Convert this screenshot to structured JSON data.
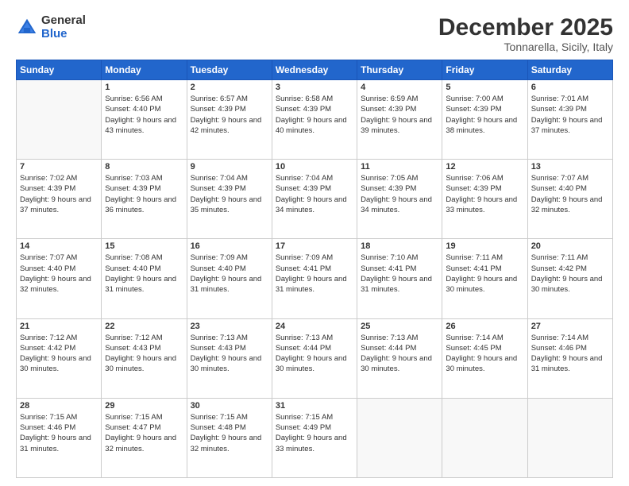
{
  "header": {
    "logo_general": "General",
    "logo_blue": "Blue",
    "title": "December 2025",
    "location": "Tonnarella, Sicily, Italy"
  },
  "days_of_week": [
    "Sunday",
    "Monday",
    "Tuesday",
    "Wednesday",
    "Thursday",
    "Friday",
    "Saturday"
  ],
  "weeks": [
    [
      {
        "num": "",
        "empty": true
      },
      {
        "num": "1",
        "sunrise": "Sunrise: 6:56 AM",
        "sunset": "Sunset: 4:40 PM",
        "daylight": "Daylight: 9 hours and 43 minutes."
      },
      {
        "num": "2",
        "sunrise": "Sunrise: 6:57 AM",
        "sunset": "Sunset: 4:39 PM",
        "daylight": "Daylight: 9 hours and 42 minutes."
      },
      {
        "num": "3",
        "sunrise": "Sunrise: 6:58 AM",
        "sunset": "Sunset: 4:39 PM",
        "daylight": "Daylight: 9 hours and 40 minutes."
      },
      {
        "num": "4",
        "sunrise": "Sunrise: 6:59 AM",
        "sunset": "Sunset: 4:39 PM",
        "daylight": "Daylight: 9 hours and 39 minutes."
      },
      {
        "num": "5",
        "sunrise": "Sunrise: 7:00 AM",
        "sunset": "Sunset: 4:39 PM",
        "daylight": "Daylight: 9 hours and 38 minutes."
      },
      {
        "num": "6",
        "sunrise": "Sunrise: 7:01 AM",
        "sunset": "Sunset: 4:39 PM",
        "daylight": "Daylight: 9 hours and 37 minutes."
      }
    ],
    [
      {
        "num": "7",
        "sunrise": "Sunrise: 7:02 AM",
        "sunset": "Sunset: 4:39 PM",
        "daylight": "Daylight: 9 hours and 37 minutes."
      },
      {
        "num": "8",
        "sunrise": "Sunrise: 7:03 AM",
        "sunset": "Sunset: 4:39 PM",
        "daylight": "Daylight: 9 hours and 36 minutes."
      },
      {
        "num": "9",
        "sunrise": "Sunrise: 7:04 AM",
        "sunset": "Sunset: 4:39 PM",
        "daylight": "Daylight: 9 hours and 35 minutes."
      },
      {
        "num": "10",
        "sunrise": "Sunrise: 7:04 AM",
        "sunset": "Sunset: 4:39 PM",
        "daylight": "Daylight: 9 hours and 34 minutes."
      },
      {
        "num": "11",
        "sunrise": "Sunrise: 7:05 AM",
        "sunset": "Sunset: 4:39 PM",
        "daylight": "Daylight: 9 hours and 34 minutes."
      },
      {
        "num": "12",
        "sunrise": "Sunrise: 7:06 AM",
        "sunset": "Sunset: 4:39 PM",
        "daylight": "Daylight: 9 hours and 33 minutes."
      },
      {
        "num": "13",
        "sunrise": "Sunrise: 7:07 AM",
        "sunset": "Sunset: 4:40 PM",
        "daylight": "Daylight: 9 hours and 32 minutes."
      }
    ],
    [
      {
        "num": "14",
        "sunrise": "Sunrise: 7:07 AM",
        "sunset": "Sunset: 4:40 PM",
        "daylight": "Daylight: 9 hours and 32 minutes."
      },
      {
        "num": "15",
        "sunrise": "Sunrise: 7:08 AM",
        "sunset": "Sunset: 4:40 PM",
        "daylight": "Daylight: 9 hours and 31 minutes."
      },
      {
        "num": "16",
        "sunrise": "Sunrise: 7:09 AM",
        "sunset": "Sunset: 4:40 PM",
        "daylight": "Daylight: 9 hours and 31 minutes."
      },
      {
        "num": "17",
        "sunrise": "Sunrise: 7:09 AM",
        "sunset": "Sunset: 4:41 PM",
        "daylight": "Daylight: 9 hours and 31 minutes."
      },
      {
        "num": "18",
        "sunrise": "Sunrise: 7:10 AM",
        "sunset": "Sunset: 4:41 PM",
        "daylight": "Daylight: 9 hours and 31 minutes."
      },
      {
        "num": "19",
        "sunrise": "Sunrise: 7:11 AM",
        "sunset": "Sunset: 4:41 PM",
        "daylight": "Daylight: 9 hours and 30 minutes."
      },
      {
        "num": "20",
        "sunrise": "Sunrise: 7:11 AM",
        "sunset": "Sunset: 4:42 PM",
        "daylight": "Daylight: 9 hours and 30 minutes."
      }
    ],
    [
      {
        "num": "21",
        "sunrise": "Sunrise: 7:12 AM",
        "sunset": "Sunset: 4:42 PM",
        "daylight": "Daylight: 9 hours and 30 minutes."
      },
      {
        "num": "22",
        "sunrise": "Sunrise: 7:12 AM",
        "sunset": "Sunset: 4:43 PM",
        "daylight": "Daylight: 9 hours and 30 minutes."
      },
      {
        "num": "23",
        "sunrise": "Sunrise: 7:13 AM",
        "sunset": "Sunset: 4:43 PM",
        "daylight": "Daylight: 9 hours and 30 minutes."
      },
      {
        "num": "24",
        "sunrise": "Sunrise: 7:13 AM",
        "sunset": "Sunset: 4:44 PM",
        "daylight": "Daylight: 9 hours and 30 minutes."
      },
      {
        "num": "25",
        "sunrise": "Sunrise: 7:13 AM",
        "sunset": "Sunset: 4:44 PM",
        "daylight": "Daylight: 9 hours and 30 minutes."
      },
      {
        "num": "26",
        "sunrise": "Sunrise: 7:14 AM",
        "sunset": "Sunset: 4:45 PM",
        "daylight": "Daylight: 9 hours and 30 minutes."
      },
      {
        "num": "27",
        "sunrise": "Sunrise: 7:14 AM",
        "sunset": "Sunset: 4:46 PM",
        "daylight": "Daylight: 9 hours and 31 minutes."
      }
    ],
    [
      {
        "num": "28",
        "sunrise": "Sunrise: 7:15 AM",
        "sunset": "Sunset: 4:46 PM",
        "daylight": "Daylight: 9 hours and 31 minutes."
      },
      {
        "num": "29",
        "sunrise": "Sunrise: 7:15 AM",
        "sunset": "Sunset: 4:47 PM",
        "daylight": "Daylight: 9 hours and 32 minutes."
      },
      {
        "num": "30",
        "sunrise": "Sunrise: 7:15 AM",
        "sunset": "Sunset: 4:48 PM",
        "daylight": "Daylight: 9 hours and 32 minutes."
      },
      {
        "num": "31",
        "sunrise": "Sunrise: 7:15 AM",
        "sunset": "Sunset: 4:49 PM",
        "daylight": "Daylight: 9 hours and 33 minutes."
      },
      {
        "num": "",
        "empty": true
      },
      {
        "num": "",
        "empty": true
      },
      {
        "num": "",
        "empty": true
      }
    ]
  ]
}
